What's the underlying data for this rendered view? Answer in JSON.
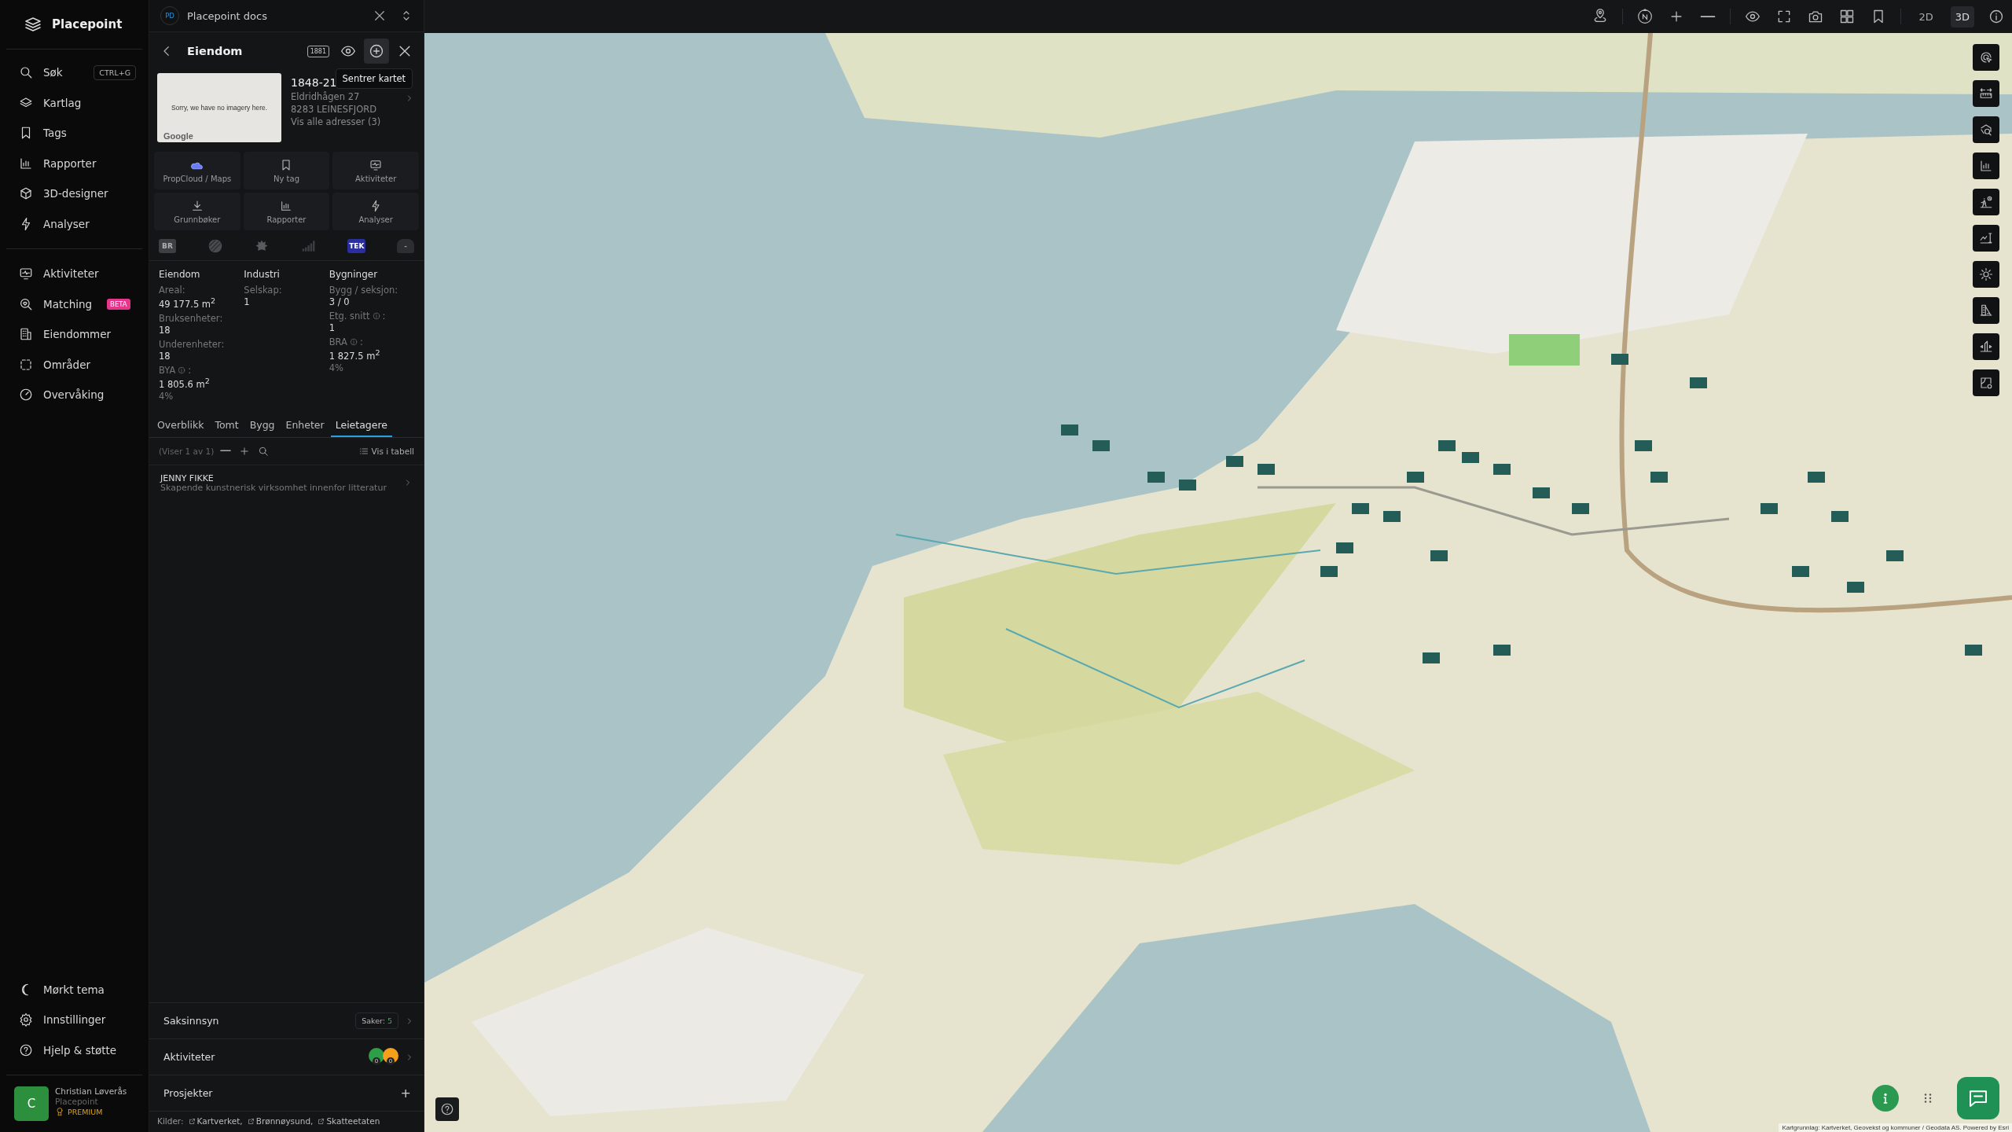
{
  "app": {
    "name": "Placepoint"
  },
  "sidebar": {
    "search": {
      "label": "Søk",
      "shortcut": "CTRL+G"
    },
    "items": [
      {
        "label": "Kartlag"
      },
      {
        "label": "Tags"
      },
      {
        "label": "Rapporter"
      },
      {
        "label": "3D-designer"
      },
      {
        "label": "Analyser"
      }
    ],
    "group2": [
      {
        "label": "Aktiviteter"
      },
      {
        "label": "Matching",
        "badge": "BETA"
      },
      {
        "label": "Eiendommer"
      },
      {
        "label": "Områder"
      },
      {
        "label": "Overvåking"
      }
    ],
    "bottom_items": [
      {
        "label": "Mørkt tema"
      },
      {
        "label": "Innstillinger"
      },
      {
        "label": "Hjelp & støtte"
      }
    ],
    "user": {
      "initial": "C",
      "name": "Christian Løverås",
      "org": "Placepoint",
      "plan": "PREMIUM"
    }
  },
  "workspace": {
    "badge": "PD",
    "title": "Placepoint docs"
  },
  "panel": {
    "title": "Eiendom",
    "header_badge": "1881",
    "tooltip": "Sentrer kartet",
    "image_text": "Sorry, we have no imagery here.",
    "image_brand": "Google",
    "property_id": "1848-21",
    "address_lines": [
      "Eldridhågen 27",
      "8283 LEINESFJORD"
    ],
    "addresses_link": "Vis alle adresser (3)",
    "actions": [
      {
        "label": "PropCloud / Maps"
      },
      {
        "label": "Ny tag"
      },
      {
        "label": "Aktiviteter"
      },
      {
        "label": "Grunnbøker"
      },
      {
        "label": "Rapporter"
      },
      {
        "label": "Analyser"
      }
    ],
    "source_badges": [
      {
        "kind": "text",
        "text": "BR"
      },
      {
        "kind": "pattern"
      },
      {
        "kind": "crest"
      },
      {
        "kind": "bars"
      },
      {
        "kind": "tek",
        "text": "TEK"
      },
      {
        "kind": "house",
        "text": "-"
      }
    ],
    "stats": [
      {
        "heading": "Eiendom",
        "fields": [
          {
            "label": "Areal:",
            "info": false,
            "value": "49 177.5 m$^{2}$"
          },
          {
            "label": "Bruksenheter:",
            "info": false,
            "value": "18"
          },
          {
            "label": "Underenheter:",
            "info": false,
            "value": "18"
          },
          {
            "label": "BYA",
            "info": true,
            "label_end": ":",
            "value": "1 805.6 m$^{2}$",
            "note": "4%"
          }
        ]
      },
      {
        "heading": "Industri",
        "fields": [
          {
            "label": "Selskap:",
            "info": false,
            "value": "1"
          }
        ]
      },
      {
        "heading": "Bygninger",
        "fields": [
          {
            "label": "Bygg / seksjon:",
            "info": false,
            "value": "3 / 0"
          },
          {
            "label": "Etg. snitt",
            "info": true,
            "label_end": ":",
            "value": "1"
          },
          {
            "label": "BRA",
            "info": true,
            "label_end": ":",
            "value": "1 827.5 m$^{2}$",
            "note": "4%"
          }
        ]
      }
    ],
    "tabs": [
      {
        "label": "Overblikk",
        "selected": false
      },
      {
        "label": "Tomt",
        "selected": false
      },
      {
        "label": "Bygg",
        "selected": false
      },
      {
        "label": "Enheter",
        "selected": false
      },
      {
        "label": "Leietagere",
        "selected": true
      }
    ],
    "list_count": "(Viser 1 av 1)",
    "table_link": "Vis i tabell",
    "tenants": [
      {
        "name": "JENNY FIKKE",
        "description": "Skapende kunstnerisk virksomhet innenfor litteratur"
      }
    ],
    "sections": [
      {
        "title": "Saksinnsyn",
        "kind": "count",
        "count_label": "Saker:",
        "count": "5"
      },
      {
        "title": "Aktiviteter",
        "kind": "activity",
        "badges": [
          {
            "color": "#2e9e48",
            "count": "0"
          },
          {
            "color": "#f5a01a",
            "count": "0"
          }
        ]
      },
      {
        "title": "Prosjekter",
        "kind": "add",
        "action": "+"
      }
    ],
    "sources_label": "Kilder:",
    "sources": [
      "Kartverket,",
      "Brønnøysund,",
      "Skatteetaten"
    ]
  },
  "map": {
    "view_modes": [
      {
        "label": "2D",
        "selected": false
      },
      {
        "label": "3D",
        "selected": true
      }
    ],
    "attribution": "Kartgrunnlag: Kartverket, Geovekst og kommuner / Geodata AS. Powered by Esri"
  }
}
